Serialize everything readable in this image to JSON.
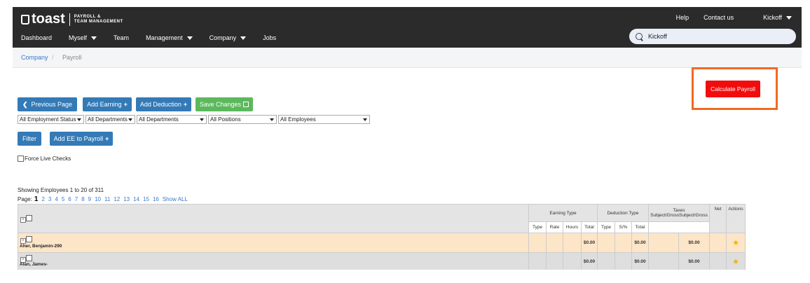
{
  "brand": {
    "name": "toast",
    "sub1": "PAYROLL &",
    "sub2": "TEAM MANAGEMENT"
  },
  "top_links": {
    "help": "Help",
    "contact": "Contact us",
    "account": "Kickoff"
  },
  "nav": [
    "Dashboard",
    "Myself",
    "Team",
    "Management",
    "Company",
    "Jobs"
  ],
  "search": {
    "value": "Kickoff",
    "icon": "search-icon"
  },
  "breadcrumb": {
    "parent": "Company",
    "sep": "/",
    "current": "Payroll"
  },
  "actions": {
    "calculate": "Calculate Payroll",
    "previous": "Previous Page",
    "add_earning": "Add Earning",
    "add_deduction": "Add Deduction",
    "save_changes": "Save Changes",
    "filter": "Filter",
    "add_ee": "Add EE to Payroll"
  },
  "filters": [
    "All Employment Status",
    "All Departments",
    "All Departments",
    "All Positions",
    "All Employees"
  ],
  "force_live_checks": "Force Live Checks",
  "showing": "Showing Employees 1 to 20 of 311",
  "pager": {
    "label": "Page:",
    "current": "1",
    "pages": [
      "2",
      "3",
      "4",
      "5",
      "6",
      "7",
      "8",
      "9",
      "10",
      "11",
      "12",
      "13",
      "14",
      "15",
      "16"
    ],
    "show_all": "Show ALL"
  },
  "table": {
    "earning_type": "Earning Type",
    "deduction_type": "Deduction Type",
    "taxes_line1": "Taxes",
    "taxes_line2": "Subject/GrossSubject/Gross",
    "net": "Net",
    "actions": "Actions",
    "earning_cols": [
      "Type",
      "Rate",
      "Hours",
      "Total"
    ],
    "deduction_cols": [
      "Type",
      "S/%",
      "Total"
    ],
    "rows": [
      {
        "name": "Aher, Benjamin-290",
        "earning_total": "$0.00",
        "deduction_total": "$0.00",
        "tax": "$0.00"
      },
      {
        "name": "Alan, James-",
        "earning_total": "$0.00",
        "deduction_total": "$0.00",
        "tax": "$0.00"
      }
    ]
  },
  "colors": {
    "topbar": "#2b2b2b",
    "calc": "#f20d0d",
    "highlight": "#f06a22",
    "primary": "#337ab7",
    "success": "#5cb85c",
    "row1": "#fde5c8",
    "row2": "#dedede"
  }
}
